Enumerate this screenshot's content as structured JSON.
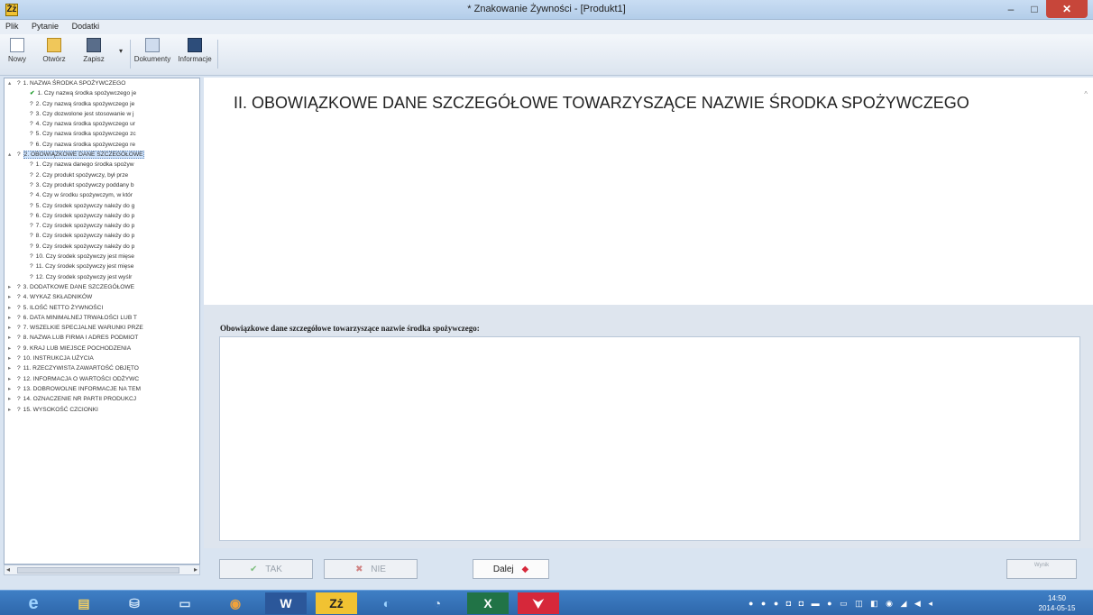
{
  "window": {
    "title": "* Znakowanie Żywności - [Produkt1]",
    "app_icon": "Żż",
    "minimize": "–",
    "maximize": "□",
    "close": "✕"
  },
  "menu": [
    "Plik",
    "Pytanie",
    "Dodatki"
  ],
  "toolbar": {
    "new_label": "Nowy",
    "open_label": "Otwórz",
    "save_label": "Zapisz",
    "dropdown": "▾",
    "documents_label": "Dokumenty",
    "info_label": "Informacje"
  },
  "tree": [
    {
      "level": 0,
      "mark": "▴",
      "prefix": "?",
      "text": "1. NAZWA ŚRODKA SPOŻYWCZEGO"
    },
    {
      "level": 1,
      "mark": "",
      "prefix": "✔",
      "done": true,
      "text": "1. Czy nazwą środka spożywczego je"
    },
    {
      "level": 1,
      "mark": "",
      "prefix": "?",
      "text": "2. Czy nazwą środka spożywczego je"
    },
    {
      "level": 1,
      "mark": "",
      "prefix": "?",
      "text": "3. Czy dozwolone jest stosowanie w j"
    },
    {
      "level": 1,
      "mark": "",
      "prefix": "?",
      "text": "4. Czy nazwa środka spożywczego ur"
    },
    {
      "level": 1,
      "mark": "",
      "prefix": "?",
      "text": "5. Czy nazwa środka spożywczego zc"
    },
    {
      "level": 1,
      "mark": "",
      "prefix": "?",
      "text": "6. Czy nazwa środka spożywczego re"
    },
    {
      "level": 0,
      "mark": "▴",
      "prefix": "?",
      "text": "2. OBOWIĄZKOWE DANE SZCZEGÓŁOWE",
      "selected": true
    },
    {
      "level": 1,
      "mark": "",
      "prefix": "?",
      "text": "1. Czy nazwa danego środka spożyw"
    },
    {
      "level": 1,
      "mark": "",
      "prefix": "?",
      "text": "2. Czy produkt spożywczy, był prze"
    },
    {
      "level": 1,
      "mark": "",
      "prefix": "?",
      "text": "3. Czy produkt spożywczy poddany b"
    },
    {
      "level": 1,
      "mark": "",
      "prefix": "?",
      "text": "4. Czy w środku spożywczym, w któr"
    },
    {
      "level": 1,
      "mark": "",
      "prefix": "?",
      "text": "5. Czy środek spożywczy należy do g"
    },
    {
      "level": 1,
      "mark": "",
      "prefix": "?",
      "text": "6. Czy środek spożywczy należy do p"
    },
    {
      "level": 1,
      "mark": "",
      "prefix": "?",
      "text": "7. Czy środek spożywczy należy do p"
    },
    {
      "level": 1,
      "mark": "",
      "prefix": "?",
      "text": "8. Czy środek spożywczy należy do p"
    },
    {
      "level": 1,
      "mark": "",
      "prefix": "?",
      "text": "9. Czy środek spożywczy należy do p"
    },
    {
      "level": 1,
      "mark": "",
      "prefix": "?",
      "text": "10. Czy środek spożywczy jest mięse"
    },
    {
      "level": 1,
      "mark": "",
      "prefix": "?",
      "text": "11. Czy środek spożywczy jest mięse"
    },
    {
      "level": 1,
      "mark": "",
      "prefix": "?",
      "text": "12. Czy środek spożywczy jest wyślr"
    },
    {
      "level": 0,
      "mark": "▸",
      "prefix": "?",
      "text": "3. DODATKOWE DANE SZCZEGÓŁOWE"
    },
    {
      "level": 0,
      "mark": "▸",
      "prefix": "?",
      "text": "4. WYKAZ SKŁADNIKÓW"
    },
    {
      "level": 0,
      "mark": "▸",
      "prefix": "?",
      "text": "5. ILOŚĆ NETTO ŻYWNOŚCI"
    },
    {
      "level": 0,
      "mark": "▸",
      "prefix": "?",
      "text": "6. DATA MINIMALNEJ TRWAŁOŚCI LUB T"
    },
    {
      "level": 0,
      "mark": "▸",
      "prefix": "?",
      "text": "7. WSZELKIE SPECJALNE WARUNKI PRZE"
    },
    {
      "level": 0,
      "mark": "▸",
      "prefix": "?",
      "text": "8. NAZWA LUB FIRMA I ADRES PODMIOT"
    },
    {
      "level": 0,
      "mark": "▸",
      "prefix": "?",
      "text": "9. KRAJ LUB MIEJSCE POCHODZENIA"
    },
    {
      "level": 0,
      "mark": "▸",
      "prefix": "?",
      "text": "10. INSTRUKCJA UŻYCIA"
    },
    {
      "level": 0,
      "mark": "▸",
      "prefix": "?",
      "text": "11. RZECZYWISTA ZAWARTOŚĆ OBJĘTO"
    },
    {
      "level": 0,
      "mark": "▸",
      "prefix": "?",
      "text": "12. INFORMACJA O WARTOŚCI ODŻYWC"
    },
    {
      "level": 0,
      "mark": "▸",
      "prefix": "?",
      "text": "13. DOBROWOLNE INFORMACJE NA TEM"
    },
    {
      "level": 0,
      "mark": "▸",
      "prefix": "?",
      "text": "14. OZNACZENIE NR PARTII PRODUKCJ"
    },
    {
      "level": 0,
      "mark": "▸",
      "prefix": "?",
      "text": "15. WYSOKOŚĆ CZCIONKI"
    }
  ],
  "content": {
    "heading": "II. OBOWIĄZKOWE DANE SZCZEGÓŁOWE TOWARZYSZĄCE NAZWIE ŚRODKA SPOŻYWCZEGO",
    "description_label": "Obowiązkowe dane szczegółowe towarzyszące nazwie środka spożywczego:",
    "description_value": ""
  },
  "buttons": {
    "tak": "TAK",
    "tak_icon": "✔",
    "nie": "NIE",
    "nie_icon": "✖",
    "dalej": "Dalej",
    "dalej_icon": "◆",
    "wynik": "Wynik"
  },
  "scrollbar": {
    "left_arrow": "◂",
    "right_arrow": "▸",
    "up_arrow": "^"
  },
  "taskbar": {
    "apps": [
      "e",
      "▤",
      "⛁",
      "▭",
      "◉",
      "W",
      "Zż",
      "◐",
      "◔",
      "X",
      "⮟"
    ],
    "tray": "● ● ● ◘ ◘ ▬ ● ▭ ◫ ◧ ◉ ◢ ◀ ◂",
    "time": "14:50",
    "date": "2014-05-15"
  }
}
